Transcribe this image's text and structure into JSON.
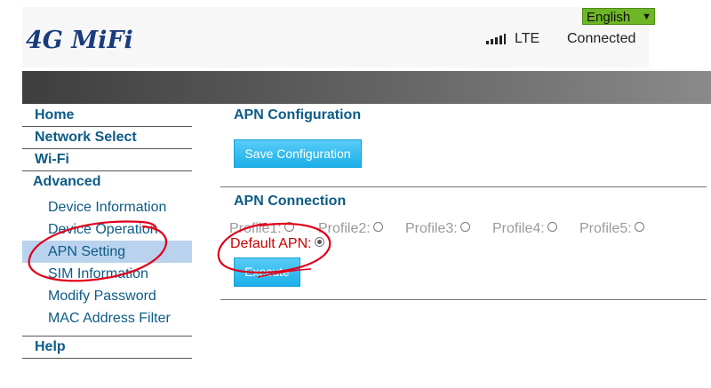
{
  "brand": {
    "logo": "4G MiFi"
  },
  "language": {
    "selected": "English"
  },
  "status": {
    "network_type": "LTE",
    "connection": "Connected"
  },
  "sidebar": {
    "home": "Home",
    "network_select": "Network Select",
    "wifi": "Wi-Fi",
    "advanced": "Advanced",
    "items": [
      {
        "label": "Device Information"
      },
      {
        "label": "Device Operation"
      },
      {
        "label": "APN Setting",
        "active": true
      },
      {
        "label": "SIM Information"
      },
      {
        "label": "Modify Password"
      },
      {
        "label": "MAC Address Filter"
      }
    ],
    "help": "Help"
  },
  "apn_config": {
    "title": "APN Configuration",
    "save_button": "Save Configuration"
  },
  "apn_connection": {
    "title": "APN Connection",
    "profiles": [
      "Profile1:",
      "Profile2:",
      "Profile3:",
      "Profile4:",
      "Profile5:"
    ],
    "default_apn_label": "Default APN:",
    "selected": "Default APN",
    "execute_button": "Execute"
  },
  "colors": {
    "nav_text": "#0d5b86",
    "button_blue": "#1cb0ea",
    "language_green": "#6fb626",
    "active_item_bg": "#b9d3ee",
    "annotation_red": "#e0001b",
    "default_apn_text": "#cc0000"
  },
  "icons": {
    "signal": "signal-bars-icon",
    "language_dropdown": "chevron-down-icon"
  }
}
